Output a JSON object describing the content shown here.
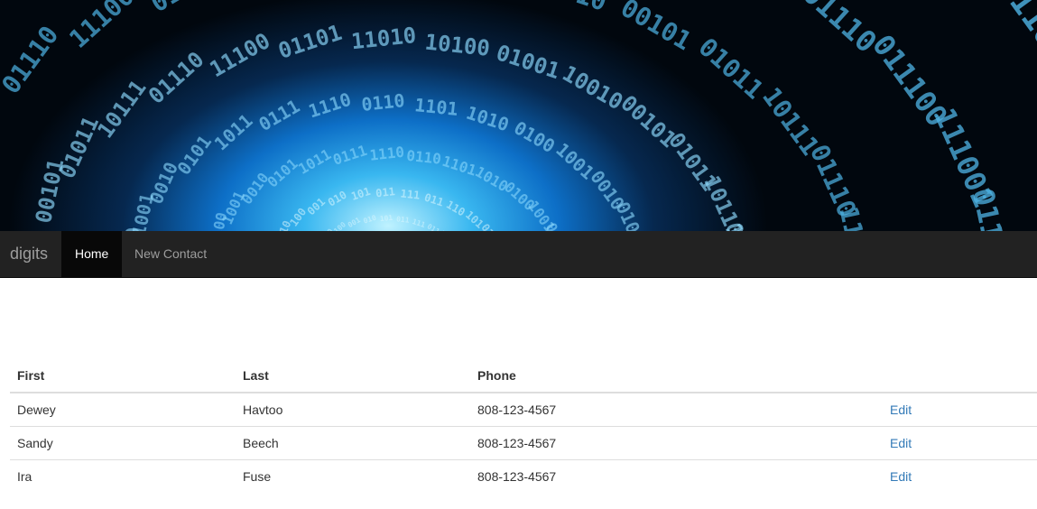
{
  "navbar": {
    "brand": "digits",
    "items": [
      {
        "label": "Home",
        "active": true
      },
      {
        "label": "New Contact",
        "active": false
      }
    ]
  },
  "table": {
    "headers": [
      "First",
      "Last",
      "Phone",
      ""
    ],
    "rows": [
      {
        "first": "Dewey",
        "last": "Havtoo",
        "phone": "808-123-4567",
        "action": "Edit"
      },
      {
        "first": "Sandy",
        "last": "Beech",
        "phone": "808-123-4567",
        "action": "Edit"
      },
      {
        "first": "Ira",
        "last": "Fuse",
        "phone": "808-123-4567",
        "action": "Edit"
      }
    ]
  },
  "colors": {
    "navbar_bg": "#222222",
    "active_bg": "#080808",
    "link": "#337ab7"
  },
  "banner": {
    "image": "binary-code-tunnel"
  }
}
